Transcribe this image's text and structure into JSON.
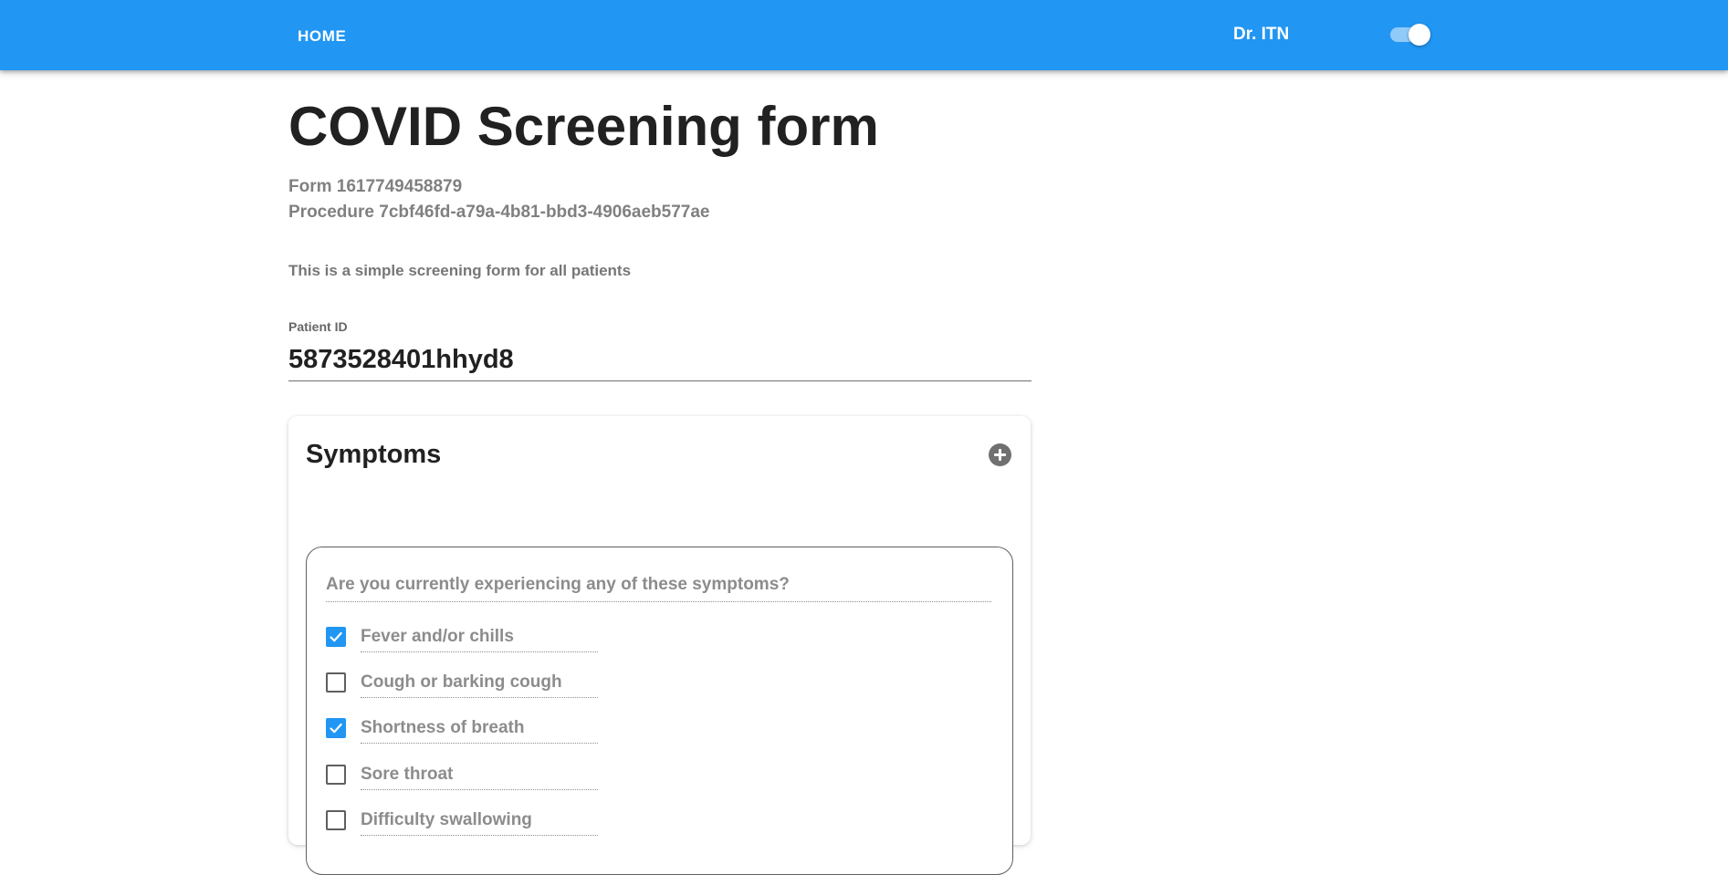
{
  "header": {
    "home_label": "HOME",
    "user_name": "Dr. ITN",
    "toggle_on": true,
    "bar_color": "#2196f3"
  },
  "form": {
    "title": "COVID Screening form",
    "form_line": "Form 1617749458879",
    "procedure_line": "Procedure 7cbf46fd-a79a-4b81-bbd3-4906aeb577ae",
    "description": "This is a simple screening form for all patients",
    "patient_id_label": "Patient ID",
    "patient_id_value": "5873528401hhyd8"
  },
  "symptoms": {
    "title": "Symptoms",
    "add_icon": "plus-circle-icon",
    "question": "Are you currently experiencing any of these symptoms?",
    "options": [
      {
        "label": "Fever and/or chills",
        "checked": true
      },
      {
        "label": "Cough or barking cough",
        "checked": false
      },
      {
        "label": "Shortness of breath",
        "checked": true
      },
      {
        "label": "Sore throat",
        "checked": false
      },
      {
        "label": "Difficulty swallowing",
        "checked": false
      }
    ],
    "check_color": "#2196f3"
  }
}
